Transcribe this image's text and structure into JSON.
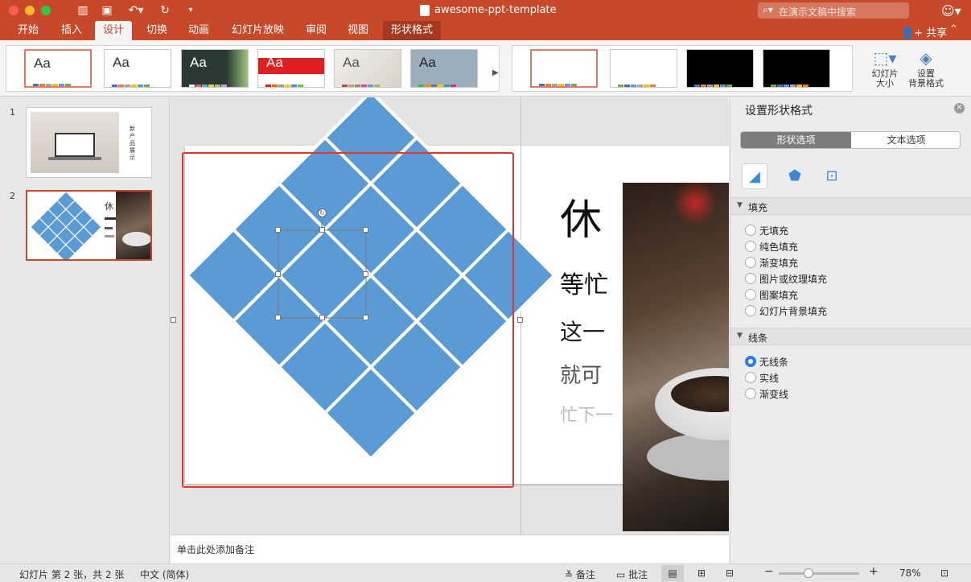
{
  "window": {
    "title": "awesome-ppt-template",
    "search_placeholder": "在演示文稿中搜索"
  },
  "tabs": [
    {
      "label": "开始"
    },
    {
      "label": "插入"
    },
    {
      "label": "设计"
    },
    {
      "label": "切换"
    },
    {
      "label": "动画"
    },
    {
      "label": "幻灯片放映"
    },
    {
      "label": "审阅"
    },
    {
      "label": "视图"
    },
    {
      "label": "形状格式"
    }
  ],
  "active_tab": "设计",
  "share_label": "共享",
  "ribbon": {
    "themes": [
      {
        "label": "Aa"
      },
      {
        "label": "Aa"
      },
      {
        "label": "Aa"
      },
      {
        "label": "Aa"
      },
      {
        "label": "Aa"
      },
      {
        "label": "Aa"
      }
    ],
    "slide_size_label": "幻灯片\n大小",
    "slide_size_line1": "幻灯片",
    "slide_size_line2": "大小",
    "bg_format_line1": "设置",
    "bg_format_line2": "背景格式"
  },
  "slides_pane": {
    "slides": [
      {
        "number": "1",
        "text": "新产品展示"
      },
      {
        "number": "2",
        "text": "休"
      }
    ]
  },
  "slide": {
    "line1": "休",
    "line2": "等忙",
    "line3": "这一",
    "line4": "就可",
    "line5": "忙下一"
  },
  "notes_placeholder": "单击此处添加备注",
  "format_pane": {
    "title": "设置形状格式",
    "segments": {
      "shape": "形状选项",
      "text": "文本选项"
    },
    "fill_section": "填充",
    "fill_options": [
      "无填充",
      "纯色填充",
      "渐变填充",
      "图片或纹理填充",
      "图案填充",
      "幻灯片背景填充"
    ],
    "line_section": "线条",
    "line_options": [
      "无线条",
      "实线",
      "渐变线"
    ],
    "line_selected": "无线条"
  },
  "statusbar": {
    "slide_info": "幻灯片 第 2 张，共 2 张",
    "language": "中文 (简体)",
    "notes": "备注",
    "comments": "批注",
    "zoom": "78%",
    "zoom_minus": "−",
    "zoom_plus": "+"
  },
  "colors": {
    "accent": "#c8482a",
    "diamond_blue": "#5b9bd5",
    "selection": "#e0382a"
  }
}
